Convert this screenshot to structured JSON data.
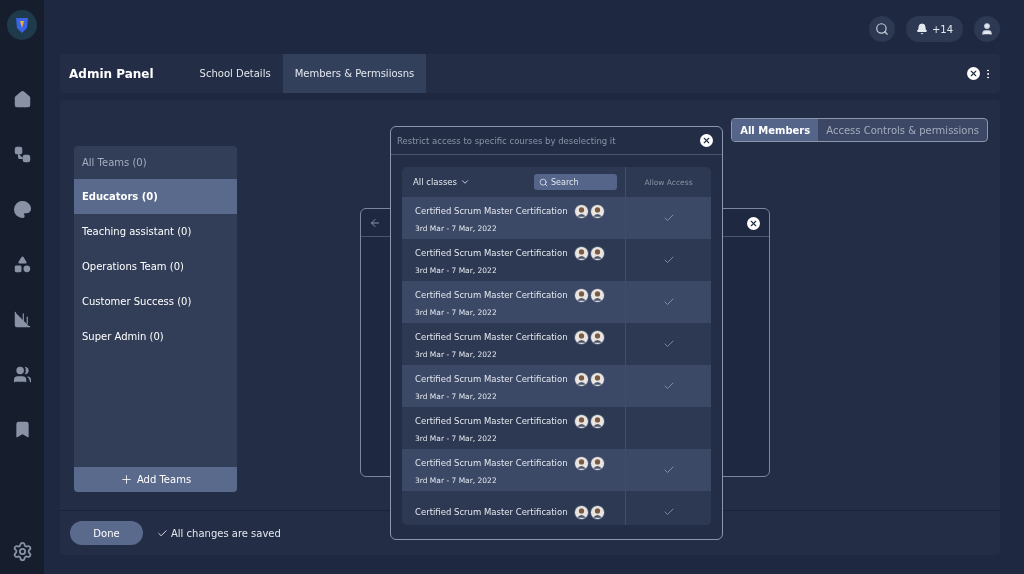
{
  "header": {
    "title": "Admin Panel",
    "tabs": [
      {
        "label": "School Details",
        "selected": false
      },
      {
        "label": "Members & Permsiiosns",
        "selected": true
      }
    ]
  },
  "notifications": {
    "count": "+14"
  },
  "view_toggle": [
    {
      "label": "All Members",
      "selected": true
    },
    {
      "label": "Access Controls & permissions",
      "selected": false
    }
  ],
  "teams": {
    "items": [
      {
        "kind": "header",
        "label": "All Teams (0)",
        "selected": false
      },
      {
        "kind": "team",
        "label": "Educators (0)",
        "selected": true
      },
      {
        "kind": "team",
        "label": "Teaching assistant (0)",
        "selected": false
      },
      {
        "kind": "team",
        "label": "Operations Team (0)",
        "selected": false
      },
      {
        "kind": "team",
        "label": "Customer Success (0)",
        "selected": false
      },
      {
        "kind": "team",
        "label": "Super Admin (0)",
        "selected": false
      }
    ],
    "add_button": "Add Teams"
  },
  "footer": {
    "done_button": "Done",
    "status": "All changes are saved"
  },
  "back_dialog": {
    "kind": "dialog"
  },
  "modal": {
    "hint": "Restrict access to specific courses by deselecting it",
    "filter": "All classes",
    "search_placeholder": "Search",
    "column": "Allow Access",
    "courses": [
      {
        "title": "Certified Scrum  Master Certification",
        "dates": "3rd Mar - 7 Mar, 2022",
        "allowed": true
      },
      {
        "title": "Certified Scrum  Master Certification",
        "dates": "3rd Mar - 7 Mar, 2022",
        "allowed": true
      },
      {
        "title": "Certified Scrum  Master Certification",
        "dates": "3rd Mar - 7 Mar, 2022",
        "allowed": true
      },
      {
        "title": "Certified Scrum  Master Certification",
        "dates": "3rd Mar - 7 Mar, 2022",
        "allowed": true
      },
      {
        "title": "Certified Scrum  Master Certification",
        "dates": "3rd Mar - 7 Mar, 2022",
        "allowed": true
      },
      {
        "title": "Certified Scrum  Master Certification",
        "dates": "3rd Mar - 7 Mar, 2022",
        "allowed": false
      },
      {
        "title": "Certified Scrum  Master Certification",
        "dates": "3rd Mar - 7 Mar, 2022",
        "allowed": true
      },
      {
        "title": "Certified Scrum  Master Certification",
        "allowed": true
      }
    ]
  }
}
